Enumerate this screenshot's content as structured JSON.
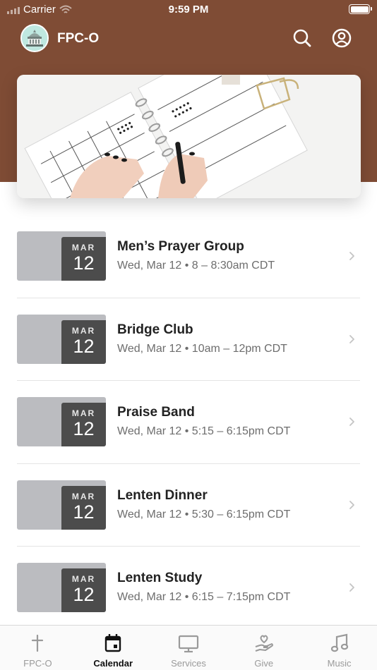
{
  "status_bar": {
    "carrier": "Carrier",
    "time": "9:59 PM"
  },
  "app": {
    "title": "FPC-O"
  },
  "events": [
    {
      "month": "MAR",
      "day": "12",
      "title": "Men’s Prayer Group",
      "meta": "Wed, Mar 12 • 8 – 8:30am CDT"
    },
    {
      "month": "MAR",
      "day": "12",
      "title": "Bridge Club",
      "meta": "Wed, Mar 12 • 10am – 12pm CDT"
    },
    {
      "month": "MAR",
      "day": "12",
      "title": "Praise Band",
      "meta": "Wed, Mar 12 • 5:15 – 6:15pm CDT"
    },
    {
      "month": "MAR",
      "day": "12",
      "title": "Lenten Dinner",
      "meta": "Wed, Mar 12 • 5:30 – 6:15pm CDT"
    },
    {
      "month": "MAR",
      "day": "12",
      "title": "Lenten Study",
      "meta": "Wed, Mar 12 • 6:15 – 7:15pm CDT"
    }
  ],
  "tabs": [
    {
      "label": "FPC-O",
      "icon": "cross-icon"
    },
    {
      "label": "Calendar",
      "icon": "calendar-icon",
      "active": true
    },
    {
      "label": "Services",
      "icon": "monitor-icon"
    },
    {
      "label": "Give",
      "icon": "give-icon"
    },
    {
      "label": "Music",
      "icon": "music-note-icon"
    }
  ],
  "colors": {
    "header": "#7f4c35",
    "date_box": "#4c4c4c",
    "date_tile": "#bbbcc0",
    "active_tab": "#111111",
    "inactive_tab": "#9a9a9a"
  }
}
